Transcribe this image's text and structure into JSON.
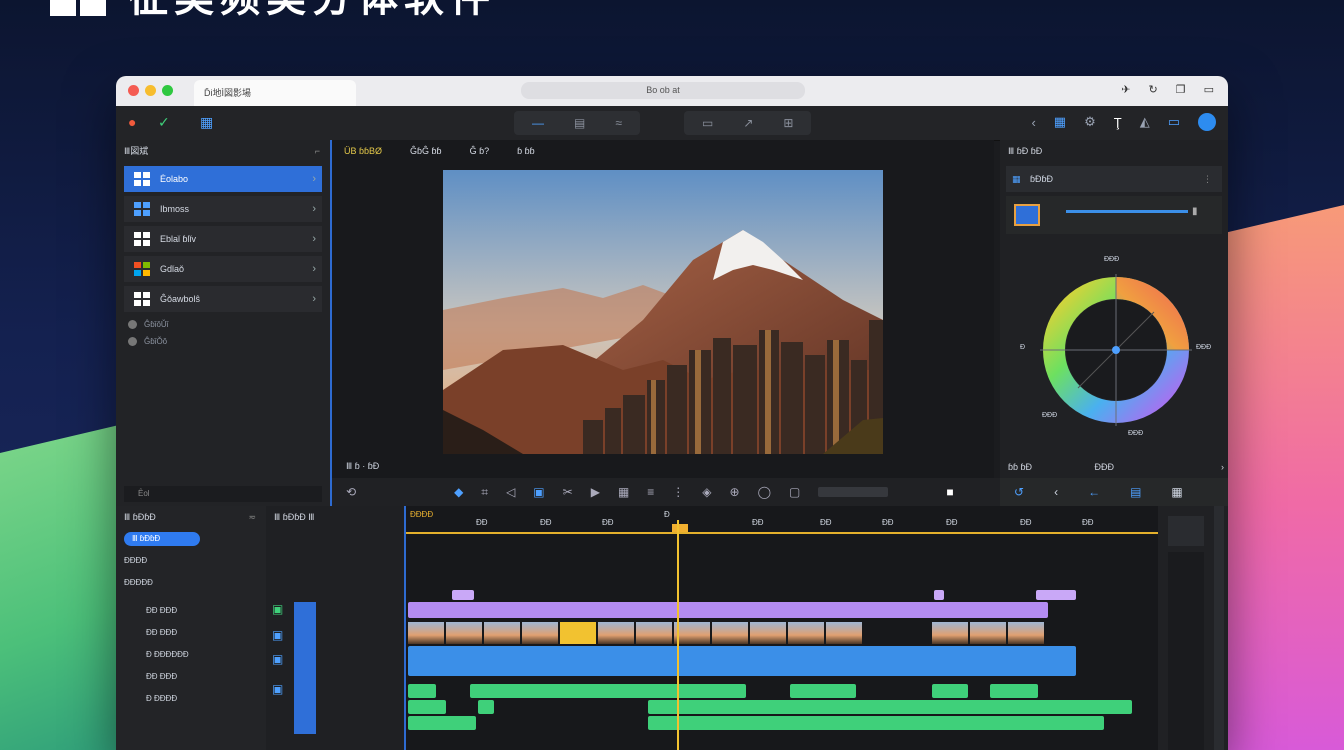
{
  "headline": {
    "text": "征类频类分体软件"
  },
  "titlebar": {
    "tab_label": "Ďi地Ì図影場",
    "url": "Bo ob at"
  },
  "left_panel": {
    "title": "Ⅲ図斌",
    "items": [
      {
        "label": "Ėolabo",
        "selected": true
      },
      {
        "label": "Ibmoss",
        "selected": false
      },
      {
        "label": "Eblaǐ ɓlǐv",
        "selected": false
      },
      {
        "label": "Gdǐaǒ",
        "selected": false
      },
      {
        "label": "Ĝǒawbolŝ",
        "selected": false
      }
    ],
    "subitems": [
      "ĜɓǐǒǓǐ",
      "ĜɓǐǑǒ"
    ],
    "footer": "Ȇol"
  },
  "viewer": {
    "tabs": [
      "ÜB ɓɓBØ",
      "ĜɓĜ ɓɓ",
      "Ĝ ɓ?",
      "ɓ ɓɓ"
    ],
    "bottom_label": "Ⅲ ɓ · ɓĐ"
  },
  "right_panel": {
    "title": "Ⅲ ɓĐ ɓĐ",
    "row1": "ɓĐɓĐ",
    "wheel_labels": {
      "top": "ĐĐĐ",
      "right": "ĐĐĐ",
      "left": "Đ",
      "bottom_left": "ĐĐĐ",
      "bottom": "ĐĐĐ"
    },
    "bottom_label": "ɓɓ ɓĐ",
    "bottom_right": "ĐĐĐ"
  },
  "media": {
    "title": "Ⅲ ɓĐɓĐ",
    "pill": "Ⅲ ɓĐɓĐ",
    "rows": [
      "ĐĐĐĐ",
      "ĐĐĐĐĐ",
      "ĐĐ ĐĐĐ",
      "ĐĐ ĐĐĐ",
      "Đ ĐĐĐĐĐĐ",
      "ĐĐ ĐĐĐ",
      "Đ ĐĐĐĐ"
    ]
  },
  "timeline": {
    "header": "Ⅲ ɓĐɓĐ Ⅲ",
    "ruler_marks": [
      "ĐĐĐĐ",
      "ĐĐ",
      "ĐĐ",
      "ĐĐ",
      "Đ",
      "ĐĐ",
      "ĐĐ",
      "ĐĐ",
      "ĐĐ",
      "ĐĐ",
      "ĐĐ"
    ]
  },
  "colors": {
    "accent": "#2d8cf0",
    "playhead": "#f2c230",
    "clip_purple": "#b48cf2",
    "clip_blue": "#3b8fe8",
    "clip_green": "#3fd07a"
  }
}
